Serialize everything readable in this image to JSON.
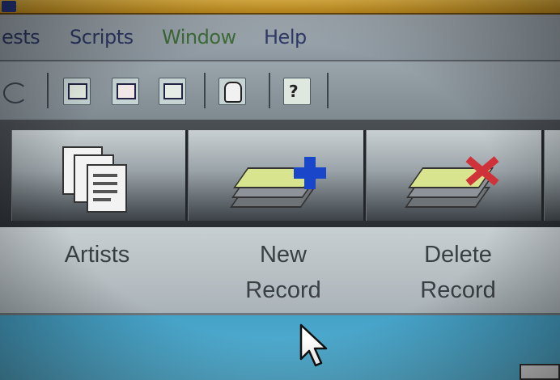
{
  "menu": {
    "items": [
      {
        "label": "ests"
      },
      {
        "label": "Scripts"
      },
      {
        "label": "Window"
      },
      {
        "label": "Help"
      }
    ]
  },
  "toolbar": {
    "icons": [
      "curl-icon",
      "note-icon",
      "note-edit-icon",
      "note-list-icon",
      "hand-icon",
      "help-icon"
    ],
    "help_glyph": "?"
  },
  "big_buttons": [
    {
      "line1": "Artists",
      "line2": "",
      "icon": "documents-icon"
    },
    {
      "line1": "New",
      "line2": "Record",
      "icon": "new-record-icon"
    },
    {
      "line1": "Delete",
      "line2": "Record",
      "icon": "delete-record-icon"
    }
  ],
  "colors": {
    "menu_text": "#2e3a66",
    "window_menu_text": "#3e6d3a",
    "new_plus": "#1a47c9",
    "delete_x": "#d0323a",
    "content_bg": "#4aa6cc"
  }
}
